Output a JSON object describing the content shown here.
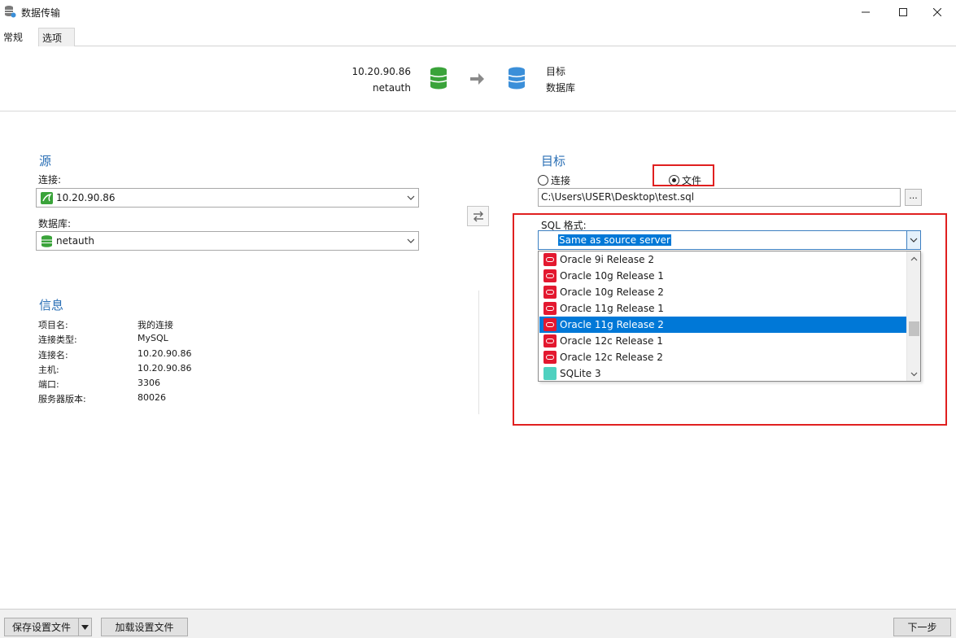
{
  "window": {
    "title": "数据传输"
  },
  "tabs": [
    {
      "label": "常规"
    },
    {
      "label": "选项"
    }
  ],
  "header": {
    "source_host": "10.20.90.86",
    "source_db": "netauth",
    "target_line1": "目标",
    "target_line2": "数据库"
  },
  "source": {
    "title": "源",
    "connection_label": "连接:",
    "connection_value": "10.20.90.86",
    "database_label": "数据库:",
    "database_value": "netauth"
  },
  "info": {
    "title": "信息",
    "rows": [
      {
        "key": "项目名:",
        "value": "我的连接"
      },
      {
        "key": "连接类型:",
        "value": "MySQL"
      },
      {
        "key": "连接名:",
        "value": "10.20.90.86"
      },
      {
        "key": "主机:",
        "value": "10.20.90.86"
      },
      {
        "key": "端口:",
        "value": "3306"
      },
      {
        "key": "服务器版本:",
        "value": "80026"
      }
    ]
  },
  "target": {
    "title": "目标",
    "radio_connection": "连接",
    "radio_file": "文件",
    "file_path": "C:\\Users\\USER\\Desktop\\test.sql",
    "browse_label": "...",
    "sql_format_label": "SQL 格式:",
    "sql_format_value": "Same as source server",
    "options": [
      {
        "label": "Oracle 9i Release 2",
        "icon": "oracle-icon",
        "selected": false
      },
      {
        "label": "Oracle 10g Release 1",
        "icon": "oracle-icon",
        "selected": false
      },
      {
        "label": "Oracle 10g Release 2",
        "icon": "oracle-icon",
        "selected": false
      },
      {
        "label": "Oracle 11g Release 1",
        "icon": "oracle-icon",
        "selected": false
      },
      {
        "label": "Oracle 11g Release 2",
        "icon": "oracle-icon",
        "selected": true
      },
      {
        "label": "Oracle 12c Release 1",
        "icon": "oracle-icon",
        "selected": false
      },
      {
        "label": "Oracle 12c Release 2",
        "icon": "oracle-icon",
        "selected": false
      },
      {
        "label": "SQLite 3",
        "icon": "sqlite-icon",
        "selected": false
      }
    ]
  },
  "footer": {
    "save_profile": "保存设置文件",
    "load_profile": "加载设置文件",
    "next": "下一步"
  },
  "colors": {
    "accent": "#2a6fb5",
    "highlight": "#0078d7",
    "annotation_red": "#e02020",
    "db_green": "#3aa33a",
    "db_blue": "#3b8fd9"
  }
}
